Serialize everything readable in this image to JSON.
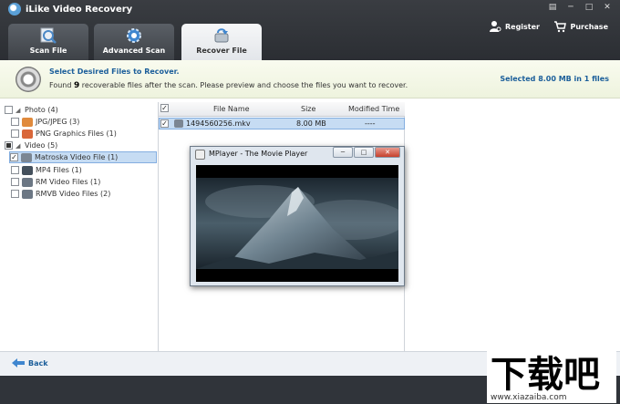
{
  "app": {
    "title": "iLike Video Recovery"
  },
  "window_controls": [
    "▤",
    "─",
    "□",
    "✕"
  ],
  "tabs": [
    {
      "label": "Scan File",
      "icon": "magnifier-icon"
    },
    {
      "label": "Advanced Scan",
      "icon": "gear-icon"
    },
    {
      "label": "Recover File",
      "icon": "recover-icon"
    }
  ],
  "header_links": {
    "register": "Register",
    "purchase": "Purchase"
  },
  "info": {
    "title": "Select Desired Files to Recover.",
    "desc_prefix": "Found",
    "count": "9",
    "desc_suffix": "recoverable files after the scan. Please preview and choose the files you want to recover.",
    "selected_summary": "Selected 8.00 MB in 1 files"
  },
  "tree": {
    "photo": {
      "label": "Photo (4)"
    },
    "jpg": {
      "label": "JPG/JPEG (3)"
    },
    "png": {
      "label": "PNG Graphics Files (1)"
    },
    "video": {
      "label": "Video (5)"
    },
    "mkv": {
      "label": "Matroska Video File (1)"
    },
    "mp4": {
      "label": "MP4 Files (1)"
    },
    "rm": {
      "label": "RM Video Files (1)"
    },
    "rmvb": {
      "label": "RMVB Video Files (2)"
    }
  },
  "file_list": {
    "headers": {
      "name": "File Name",
      "size": "Size",
      "modified": "Modified Time"
    },
    "rows": [
      {
        "name": "1494560256.mkv",
        "size": "8.00 MB",
        "modified": "----"
      }
    ]
  },
  "player": {
    "title": "MPlayer - The Movie Player"
  },
  "bottom": {
    "back": "Back"
  },
  "watermark": {
    "text": "下载吧",
    "url": "www.xiazaiba.com"
  }
}
